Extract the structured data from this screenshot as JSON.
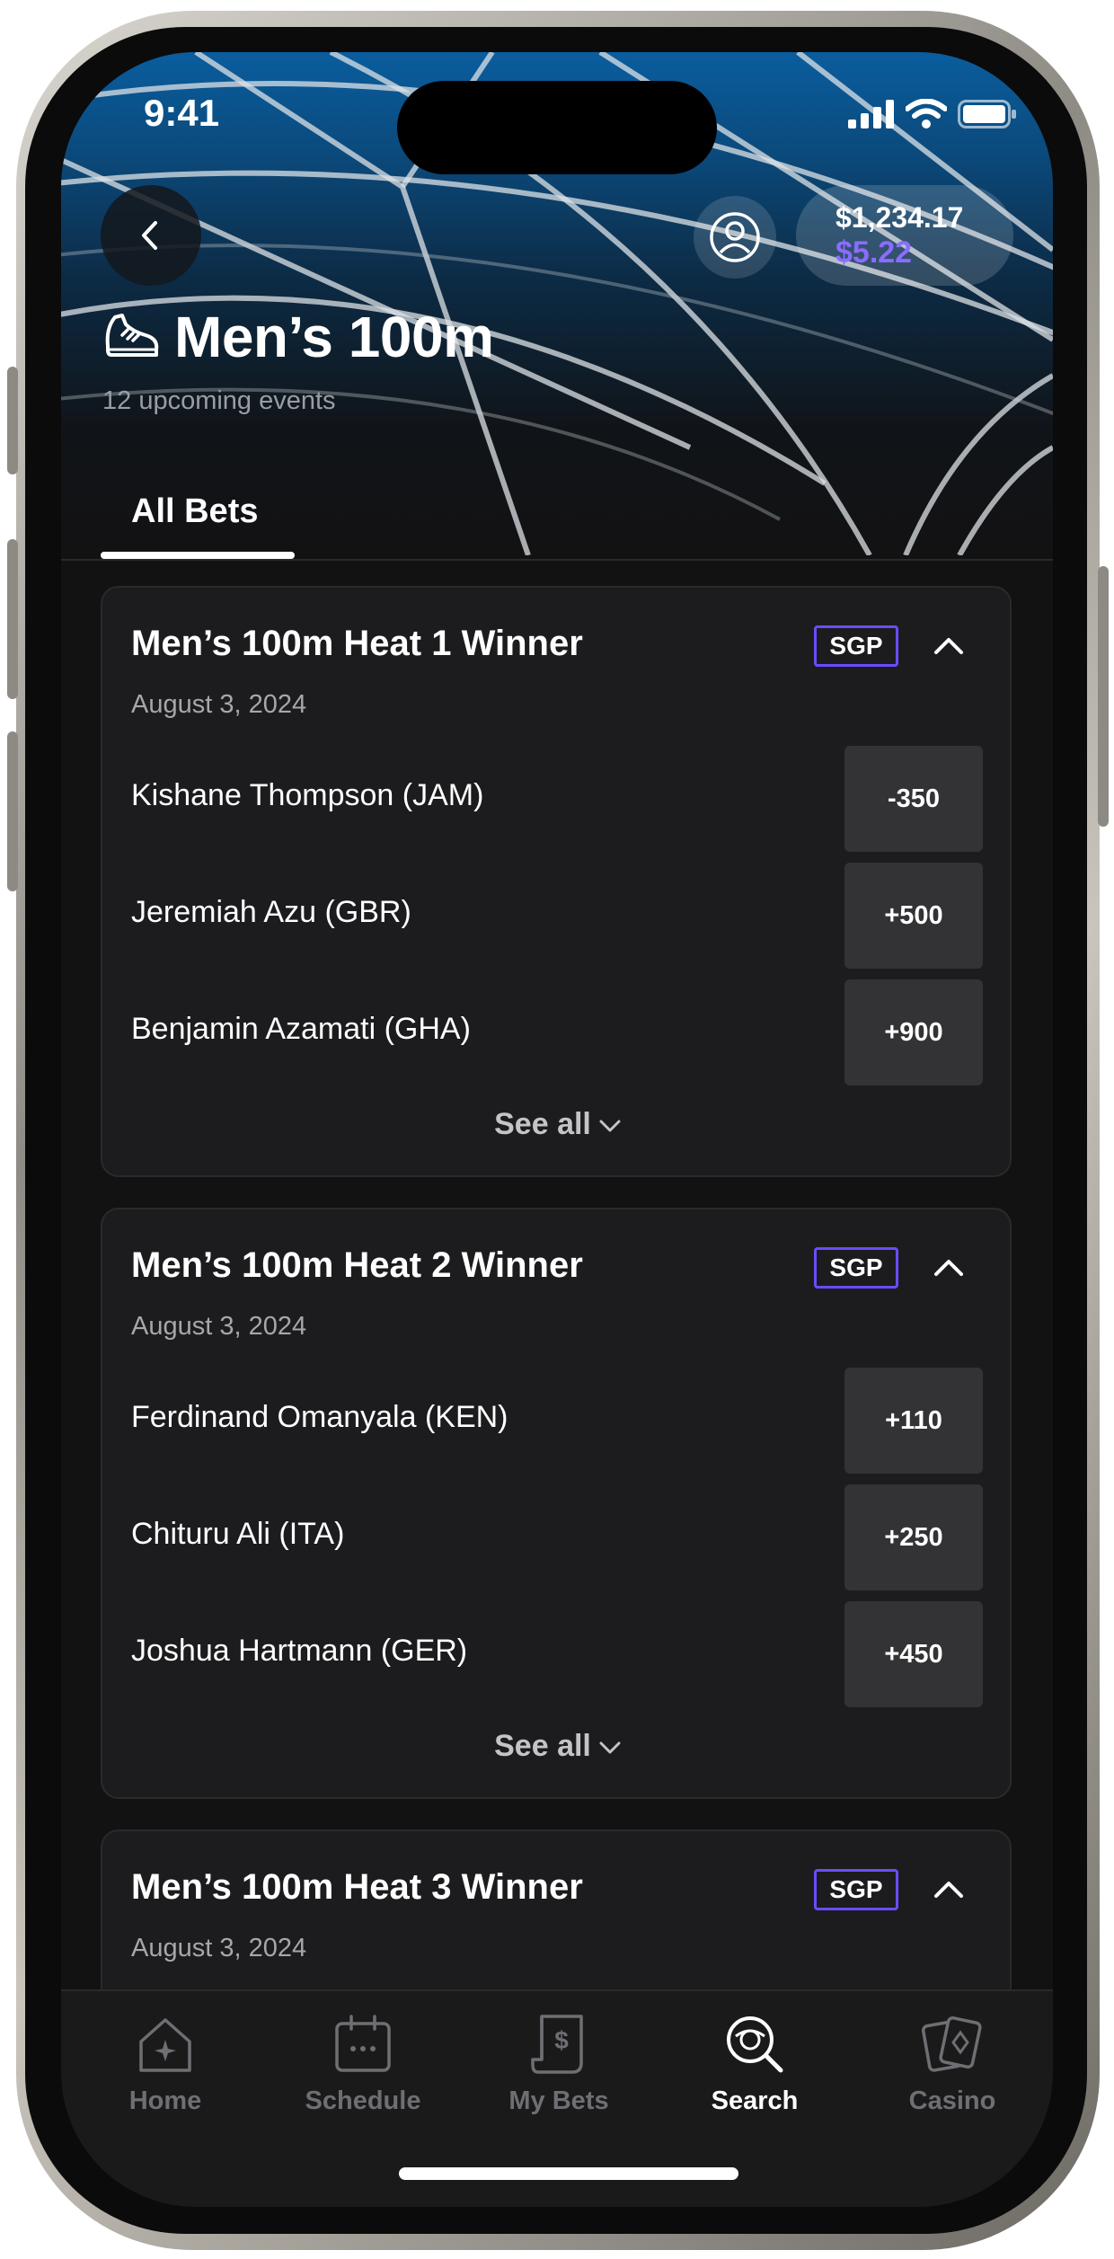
{
  "status_bar": {
    "time": "9:41"
  },
  "header": {
    "balance_main": "$1,234.17",
    "balance_bonus": "$5.22",
    "title": "Men’s 100m",
    "subtitle": "12 upcoming events"
  },
  "tabs": [
    {
      "label": "All Bets",
      "active": true
    }
  ],
  "markets": [
    {
      "title": "Men’s 100m Heat 1 Winner",
      "badge": "SGP",
      "date": "August 3, 2024",
      "runners": [
        {
          "name": "Kishane Thompson (JAM)",
          "odds": "-350"
        },
        {
          "name": "Jeremiah Azu (GBR)",
          "odds": "+500"
        },
        {
          "name": "Benjamin Azamati (GHA)",
          "odds": "+900"
        }
      ],
      "see_all": "See all"
    },
    {
      "title": "Men’s 100m Heat 2 Winner",
      "badge": "SGP",
      "date": "August 3, 2024",
      "runners": [
        {
          "name": "Ferdinand Omanyala (KEN)",
          "odds": "+110"
        },
        {
          "name": "Chituru Ali (ITA)",
          "odds": "+250"
        },
        {
          "name": "Joshua Hartmann (GER)",
          "odds": "+450"
        }
      ],
      "see_all": "See all"
    },
    {
      "title": "Men’s 100m Heat 3 Winner",
      "badge": "SGP",
      "date": "August 3, 2024"
    }
  ],
  "bottom_nav": [
    {
      "label": "Home",
      "icon": "home-star-icon",
      "active": false
    },
    {
      "label": "Schedule",
      "icon": "calendar-icon",
      "active": false
    },
    {
      "label": "My Bets",
      "icon": "bet-slip-icon",
      "active": false
    },
    {
      "label": "Search",
      "icon": "search-icon",
      "active": true
    },
    {
      "label": "Casino",
      "icon": "cards-icon",
      "active": false
    }
  ],
  "colors": {
    "accent_purple": "#6a4cff",
    "bonus_text": "#8b6cff",
    "card_bg": "#1c1c1e",
    "odds_bg": "#333335",
    "screen_bg": "#121213"
  }
}
